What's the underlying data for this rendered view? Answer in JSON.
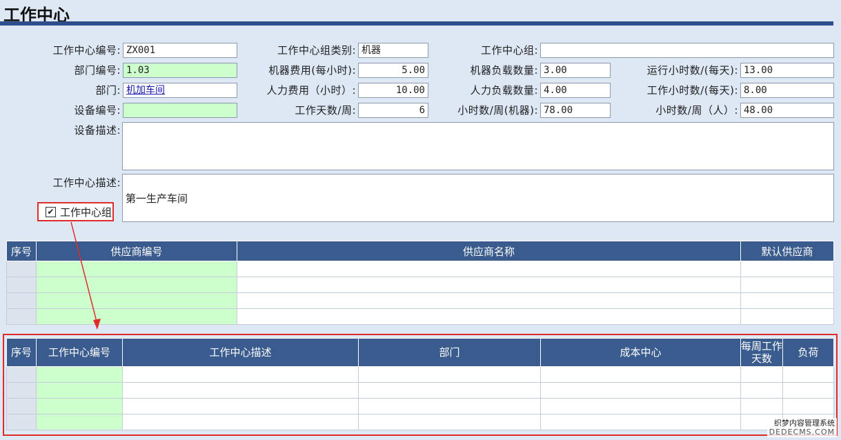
{
  "page_title": "工作中心",
  "form": {
    "code_label": "工作中心编号:",
    "code_value": "ZX001",
    "dept_code_label": "部门编号:",
    "dept_code_value": "1.03",
    "dept_label": "部门:",
    "dept_value": "机加车间",
    "equip_code_label": "设备编号:",
    "equip_code_value": "",
    "equip_desc_label": "设备描述:",
    "equip_desc_value": "",
    "wc_desc_label": "工作中心描述:",
    "wc_desc_value": "第一生产车间",
    "group_type_label": "工作中心组类别:",
    "group_type_value": "机器",
    "machine_cost_label": "机器费用(每小时):",
    "machine_cost_value": "5.00",
    "labor_cost_label": "人力费用（小时）:",
    "labor_cost_value": "10.00",
    "workdays_label": "工作天数/周:",
    "workdays_value": "6",
    "group_label": "工作中心组:",
    "group_value": "",
    "machine_load_label": "机器负载数量:",
    "machine_load_value": "3.00",
    "labor_load_label": "人力负载数量:",
    "labor_load_value": "4.00",
    "hours_machine_label": "小时数/周(机器):",
    "hours_machine_value": "78.00",
    "run_hours_label": "运行小时数/(每天):",
    "run_hours_value": "13.00",
    "work_hours_label": "工作小时数/(每天):",
    "work_hours_value": "8.00",
    "hours_person_label": "小时数/周（人）:",
    "hours_person_value": "48.00",
    "is_group_label": "工作中心组",
    "is_group_checked": "✔"
  },
  "supplier_grid": {
    "headers": [
      "序号",
      "供应商编号",
      "供应商名称",
      "默认供应商"
    ],
    "row_count": 4
  },
  "wc_grid": {
    "headers": [
      "序号",
      "工作中心编号",
      "工作中心描述",
      "部门",
      "成本中心",
      "每周工作天数",
      "负荷"
    ],
    "row_count": 4
  },
  "watermark": {
    "line1": "织梦内容管理系统",
    "line2": "DEDECMS.COM"
  },
  "colors": {
    "header_bg": "#3a5b8e",
    "highlight": "#e02b2b",
    "required_field": "#ccffcc"
  }
}
